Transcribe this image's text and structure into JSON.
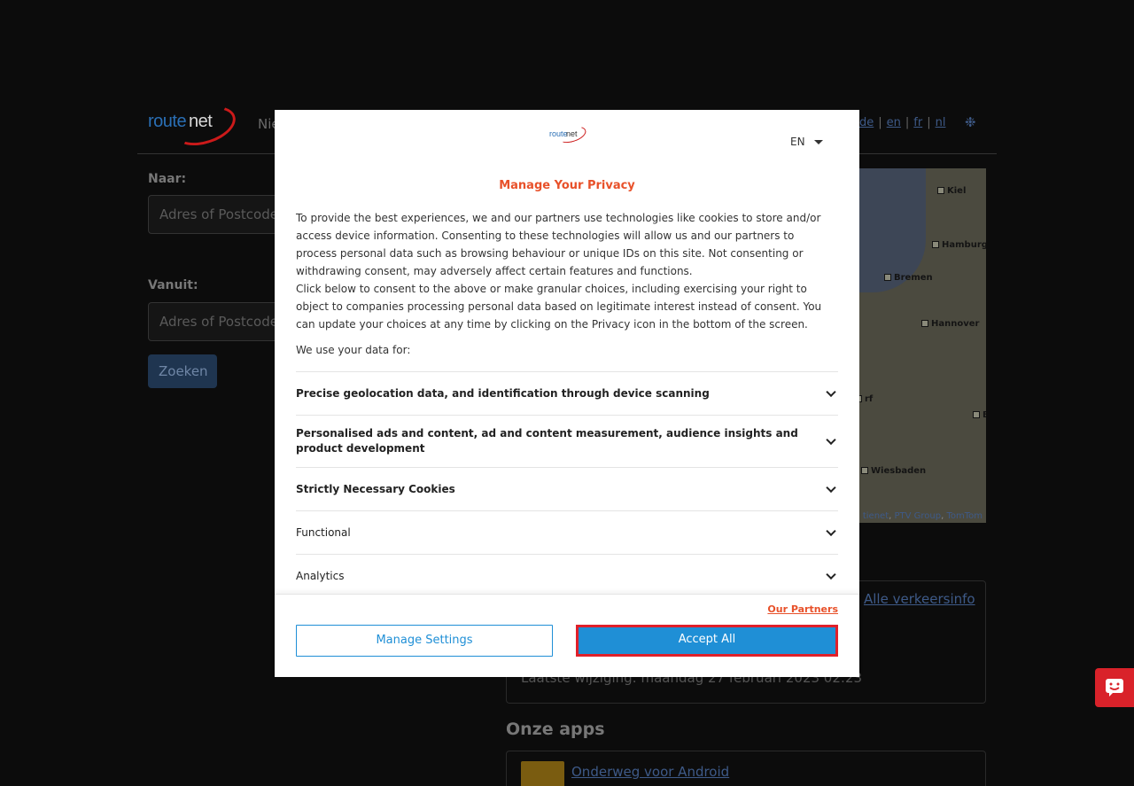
{
  "header": {
    "logo_text_a": "route",
    "logo_text_b": "net",
    "nav_partial": "Nie",
    "languages": [
      "de",
      "en",
      "fr",
      "nl"
    ],
    "gear_icon": "gear-icon"
  },
  "form": {
    "to_label": "Naar:",
    "to_placeholder": "Adres of Postcode",
    "from_label": "Vanuit:",
    "from_placeholder": "Adres of Postcode",
    "search_button": "Zoeken"
  },
  "map": {
    "cities": [
      "Kiel",
      "Hamburg",
      "Bremen",
      "Hannover",
      "rf",
      "B",
      "Wiesbaden"
    ],
    "attribution_prefix": "tienet",
    "attribution_links": [
      "PTV Group",
      "TomTom"
    ]
  },
  "traffic": {
    "all_link": "Alle verkeersinfo",
    "last_modified": "Laatste wijziging: maandag 27 februari 2023 02:23"
  },
  "apps": {
    "title": "Onze apps",
    "android_link": "Onderweg voor Android"
  },
  "modal": {
    "language": "EN",
    "title": "Manage Your Privacy",
    "paragraph1": "To provide the best experiences, we and our partners use technologies like cookies to store and/or access device information. Consenting to these technologies will allow us and our partners to process personal data such as browsing behaviour or unique IDs on this site. Not consenting or withdrawing consent, may adversely affect certain features and functions.",
    "paragraph2": "Click below to consent to the above or make granular choices, including exercising your right to object to companies processing personal data based on legitimate interest instead of consent. You can update your choices at any time by clicking on the Privacy icon in the bottom of the screen.",
    "use_data_for": "We use your data for:",
    "purposes": [
      "Precise geolocation data, and identification through device scanning",
      "Personalised ads and content, ad and content measurement, audience insights and product development",
      "Strictly Necessary Cookies",
      "Functional",
      "Analytics"
    ],
    "partners_link": "Our Partners",
    "manage_button": "Manage Settings",
    "accept_button": "Accept All"
  },
  "colors": {
    "accent_orange": "#e8512a",
    "button_blue": "#1f8fd6",
    "highlight_red": "#e0202a"
  }
}
